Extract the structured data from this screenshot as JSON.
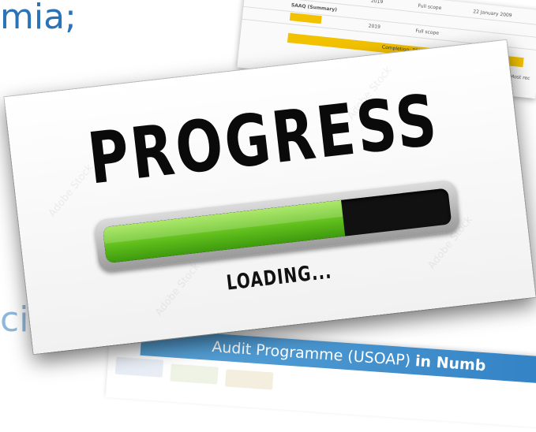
{
  "background_slide": {
    "text_top": "mia;",
    "text_bottom": "cia de la"
  },
  "doc_card": {
    "row1": [
      "2019",
      "Full scope",
      "22 January 2009"
    ],
    "row2_left": "SAAQ (Summary)",
    "row3_left": "2019",
    "row3_mid": "Full scope",
    "completion_label": "Completion: 86%",
    "side_text": "Most rec",
    "accent_color": "#f2c100"
  },
  "progress_card": {
    "heading": "PROGRESS",
    "status": "LOADING...",
    "progress_fraction": 0.69,
    "fill_color": "#5fbe1c",
    "watermark": "Adobe Stock"
  },
  "banner": {
    "text_plain": "Audit Programme (USOAP)",
    "text_bold": "in Numb",
    "color": "#2f7fc3"
  }
}
